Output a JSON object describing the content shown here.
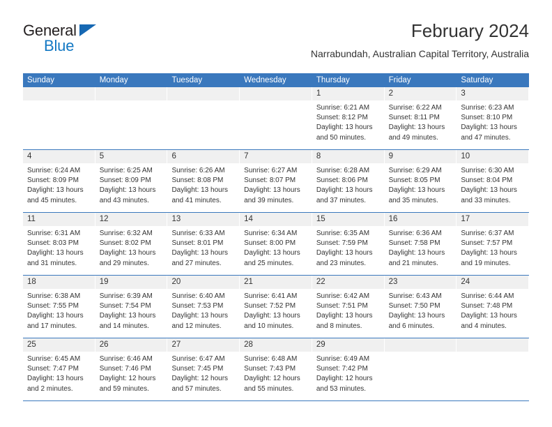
{
  "brand": {
    "name_part1": "General",
    "name_part2": "Blue",
    "colors": {
      "dark": "#231f20",
      "blue": "#1479c4",
      "header_blue": "#3a78bd",
      "strip_gray": "#f0f0f0"
    }
  },
  "header": {
    "title": "February 2024",
    "subtitle": "Narrabundah, Australian Capital Territory, Australia"
  },
  "calendar": {
    "weekday_headers": [
      "Sunday",
      "Monday",
      "Tuesday",
      "Wednesday",
      "Thursday",
      "Friday",
      "Saturday"
    ],
    "weeks": [
      [
        {
          "day": "",
          "lines": []
        },
        {
          "day": "",
          "lines": []
        },
        {
          "day": "",
          "lines": []
        },
        {
          "day": "",
          "lines": []
        },
        {
          "day": "1",
          "lines": [
            "Sunrise: 6:21 AM",
            "Sunset: 8:12 PM",
            "Daylight: 13 hours",
            "and 50 minutes."
          ]
        },
        {
          "day": "2",
          "lines": [
            "Sunrise: 6:22 AM",
            "Sunset: 8:11 PM",
            "Daylight: 13 hours",
            "and 49 minutes."
          ]
        },
        {
          "day": "3",
          "lines": [
            "Sunrise: 6:23 AM",
            "Sunset: 8:10 PM",
            "Daylight: 13 hours",
            "and 47 minutes."
          ]
        }
      ],
      [
        {
          "day": "4",
          "lines": [
            "Sunrise: 6:24 AM",
            "Sunset: 8:09 PM",
            "Daylight: 13 hours",
            "and 45 minutes."
          ]
        },
        {
          "day": "5",
          "lines": [
            "Sunrise: 6:25 AM",
            "Sunset: 8:09 PM",
            "Daylight: 13 hours",
            "and 43 minutes."
          ]
        },
        {
          "day": "6",
          "lines": [
            "Sunrise: 6:26 AM",
            "Sunset: 8:08 PM",
            "Daylight: 13 hours",
            "and 41 minutes."
          ]
        },
        {
          "day": "7",
          "lines": [
            "Sunrise: 6:27 AM",
            "Sunset: 8:07 PM",
            "Daylight: 13 hours",
            "and 39 minutes."
          ]
        },
        {
          "day": "8",
          "lines": [
            "Sunrise: 6:28 AM",
            "Sunset: 8:06 PM",
            "Daylight: 13 hours",
            "and 37 minutes."
          ]
        },
        {
          "day": "9",
          "lines": [
            "Sunrise: 6:29 AM",
            "Sunset: 8:05 PM",
            "Daylight: 13 hours",
            "and 35 minutes."
          ]
        },
        {
          "day": "10",
          "lines": [
            "Sunrise: 6:30 AM",
            "Sunset: 8:04 PM",
            "Daylight: 13 hours",
            "and 33 minutes."
          ]
        }
      ],
      [
        {
          "day": "11",
          "lines": [
            "Sunrise: 6:31 AM",
            "Sunset: 8:03 PM",
            "Daylight: 13 hours",
            "and 31 minutes."
          ]
        },
        {
          "day": "12",
          "lines": [
            "Sunrise: 6:32 AM",
            "Sunset: 8:02 PM",
            "Daylight: 13 hours",
            "and 29 minutes."
          ]
        },
        {
          "day": "13",
          "lines": [
            "Sunrise: 6:33 AM",
            "Sunset: 8:01 PM",
            "Daylight: 13 hours",
            "and 27 minutes."
          ]
        },
        {
          "day": "14",
          "lines": [
            "Sunrise: 6:34 AM",
            "Sunset: 8:00 PM",
            "Daylight: 13 hours",
            "and 25 minutes."
          ]
        },
        {
          "day": "15",
          "lines": [
            "Sunrise: 6:35 AM",
            "Sunset: 7:59 PM",
            "Daylight: 13 hours",
            "and 23 minutes."
          ]
        },
        {
          "day": "16",
          "lines": [
            "Sunrise: 6:36 AM",
            "Sunset: 7:58 PM",
            "Daylight: 13 hours",
            "and 21 minutes."
          ]
        },
        {
          "day": "17",
          "lines": [
            "Sunrise: 6:37 AM",
            "Sunset: 7:57 PM",
            "Daylight: 13 hours",
            "and 19 minutes."
          ]
        }
      ],
      [
        {
          "day": "18",
          "lines": [
            "Sunrise: 6:38 AM",
            "Sunset: 7:55 PM",
            "Daylight: 13 hours",
            "and 17 minutes."
          ]
        },
        {
          "day": "19",
          "lines": [
            "Sunrise: 6:39 AM",
            "Sunset: 7:54 PM",
            "Daylight: 13 hours",
            "and 14 minutes."
          ]
        },
        {
          "day": "20",
          "lines": [
            "Sunrise: 6:40 AM",
            "Sunset: 7:53 PM",
            "Daylight: 13 hours",
            "and 12 minutes."
          ]
        },
        {
          "day": "21",
          "lines": [
            "Sunrise: 6:41 AM",
            "Sunset: 7:52 PM",
            "Daylight: 13 hours",
            "and 10 minutes."
          ]
        },
        {
          "day": "22",
          "lines": [
            "Sunrise: 6:42 AM",
            "Sunset: 7:51 PM",
            "Daylight: 13 hours",
            "and 8 minutes."
          ]
        },
        {
          "day": "23",
          "lines": [
            "Sunrise: 6:43 AM",
            "Sunset: 7:50 PM",
            "Daylight: 13 hours",
            "and 6 minutes."
          ]
        },
        {
          "day": "24",
          "lines": [
            "Sunrise: 6:44 AM",
            "Sunset: 7:48 PM",
            "Daylight: 13 hours",
            "and 4 minutes."
          ]
        }
      ],
      [
        {
          "day": "25",
          "lines": [
            "Sunrise: 6:45 AM",
            "Sunset: 7:47 PM",
            "Daylight: 13 hours",
            "and 2 minutes."
          ]
        },
        {
          "day": "26",
          "lines": [
            "Sunrise: 6:46 AM",
            "Sunset: 7:46 PM",
            "Daylight: 12 hours",
            "and 59 minutes."
          ]
        },
        {
          "day": "27",
          "lines": [
            "Sunrise: 6:47 AM",
            "Sunset: 7:45 PM",
            "Daylight: 12 hours",
            "and 57 minutes."
          ]
        },
        {
          "day": "28",
          "lines": [
            "Sunrise: 6:48 AM",
            "Sunset: 7:43 PM",
            "Daylight: 12 hours",
            "and 55 minutes."
          ]
        },
        {
          "day": "29",
          "lines": [
            "Sunrise: 6:49 AM",
            "Sunset: 7:42 PM",
            "Daylight: 12 hours",
            "and 53 minutes."
          ]
        },
        {
          "day": "",
          "lines": []
        },
        {
          "day": "",
          "lines": []
        }
      ]
    ]
  }
}
